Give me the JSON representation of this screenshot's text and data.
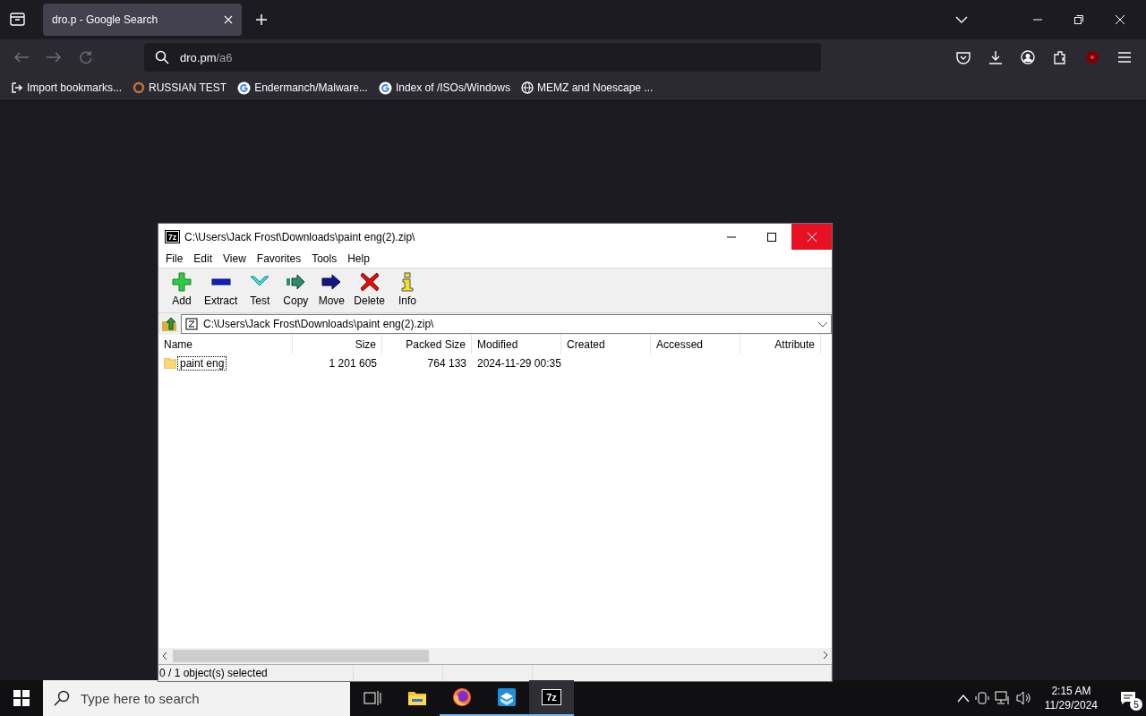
{
  "browser": {
    "tabs": [
      {
        "title": "dro.p - Google Search",
        "selected": true
      }
    ],
    "address": {
      "host": "dro.pm",
      "path": "/a6"
    },
    "bookmarks": [
      {
        "label": "Import bookmarks...",
        "kind": "import"
      },
      {
        "label": "RUSSIAN TEST",
        "kind": "site"
      },
      {
        "label": "Endermanch/Malware...",
        "kind": "google"
      },
      {
        "label": "Index of /ISOs/Windows",
        "kind": "google"
      },
      {
        "label": "MEMZ and Noescape ...",
        "kind": "globe"
      }
    ]
  },
  "archive_window": {
    "logo": "7z",
    "title": "C:\\Users\\Jack Frost\\Downloads\\paint eng(2).zip\\",
    "close_hovered": true,
    "menu": [
      "File",
      "Edit",
      "View",
      "Favorites",
      "Tools",
      "Help"
    ],
    "toolbar": [
      {
        "label": "Add",
        "kind": "add"
      },
      {
        "label": "Extract",
        "kind": "extract"
      },
      {
        "label": "Test",
        "kind": "test"
      },
      {
        "label": "Copy",
        "kind": "copy"
      },
      {
        "label": "Move",
        "kind": "move"
      },
      {
        "label": "Delete",
        "kind": "delete"
      },
      {
        "label": "Info",
        "kind": "info"
      }
    ],
    "path": "C:\\Users\\Jack Frost\\Downloads\\paint eng(2).zip\\",
    "columns": [
      "Name",
      "Size",
      "Packed Size",
      "Modified",
      "Created",
      "Accessed",
      "Attribute"
    ],
    "rows": [
      {
        "name": "paint eng",
        "size": "1 201 605",
        "packed_size": "764 133",
        "modified": "2024-11-29 00:35",
        "focused": true
      }
    ],
    "status": "0 / 1 object(s) selected"
  },
  "taskbar": {
    "search": {
      "placeholder": "Type here to search"
    },
    "apps": [
      {
        "kind": "taskview",
        "running": false,
        "active": false
      },
      {
        "kind": "explorer",
        "running": false,
        "active": false
      },
      {
        "kind": "firefox",
        "running": true,
        "active": false
      },
      {
        "kind": "box",
        "running": true,
        "active": false
      },
      {
        "kind": "sevenzip",
        "label": "7z",
        "running": true,
        "active": true
      }
    ],
    "time": "2:15 AM",
    "date": "11/29/2024",
    "notifications": "5"
  }
}
